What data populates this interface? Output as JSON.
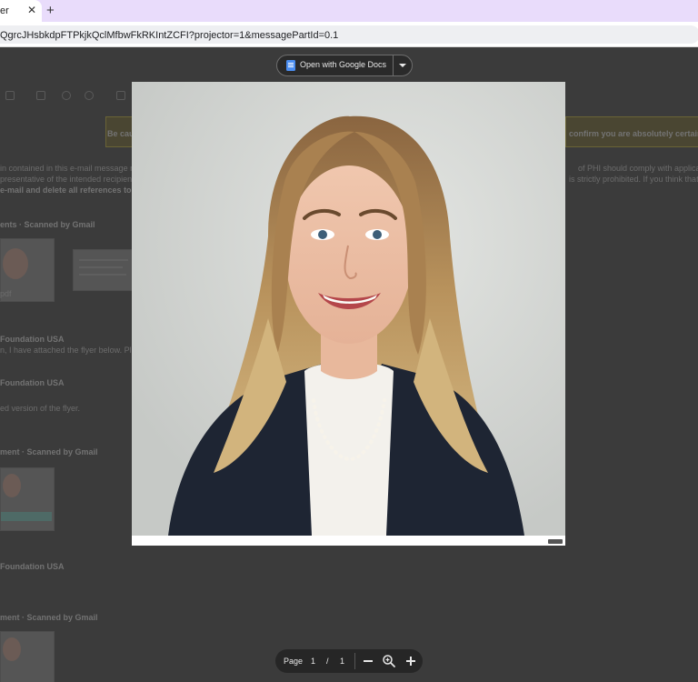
{
  "browser": {
    "tab_title": "er",
    "tab_close": "✕",
    "new_tab": "+",
    "url": "QgrcJHsbkdpFTPkjkQclMfbwFkRKIntZCFI?projector=1&messagePartId=0.1"
  },
  "viewer": {
    "open_with_label": "Open with Google Docs",
    "open_icon": "google-docs-icon",
    "dropdown_icon": "caret-down-icon",
    "image_kind": "portrait photograph"
  },
  "pager": {
    "page_label": "Page",
    "current_page": "1",
    "separator": "/",
    "total_pages": "1",
    "zoom_out_icon": "minus-icon",
    "zoom_icon": "zoom-in-magnifier-icon",
    "zoom_in_icon": "plus-icon"
  },
  "background": {
    "warning_text": "Be cautious",
    "warning_right": "confirm you are absolutely certain it",
    "body_line_1": "in contained in this e-mail message may b",
    "body_line_2": "presentative of the intended recipient, any",
    "body_line_3": "e-mail and delete all references to it ar",
    "body_right_1": "of PHI should comply with applicable fe",
    "body_right_2": "is strictly prohibited. If you think that",
    "attachments_1": "ents · Scanned by Gmail",
    "attachment_name": "pdf",
    "sender_1": "Foundation USA",
    "snippet_1": "n, I have attached the flyer below. Please",
    "sender_2": "Foundation USA",
    "sender_2_meta": "",
    "snippet_2": "ed version of the flyer.",
    "attachments_2": "ment · Scanned by Gmail",
    "sender_3": "Foundation USA",
    "attachments_3": "ment · Scanned by Gmail"
  },
  "colors": {
    "tabbar": "#e9dcfb",
    "overlay": "#3b3b3b",
    "docs_blue": "#4b8ef1"
  }
}
